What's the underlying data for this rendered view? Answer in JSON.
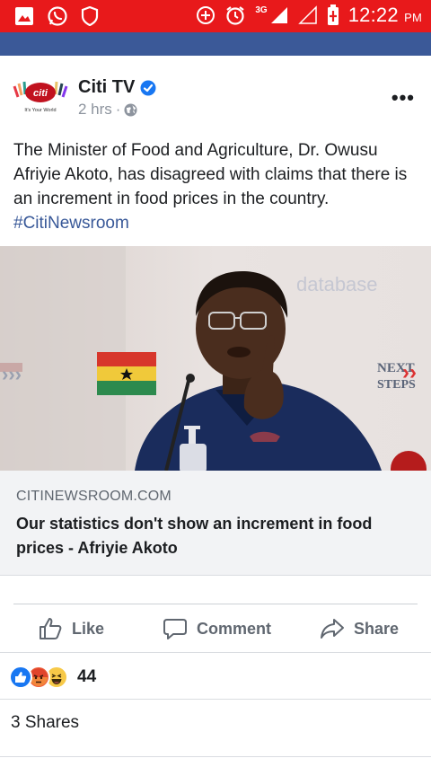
{
  "status_bar": {
    "time": "12:22",
    "ampm": "PM",
    "network": "3G",
    "colors": {
      "background": "#e8191b"
    }
  },
  "post": {
    "page_name": "Citi TV",
    "avatar_text": "citi",
    "avatar_tagline": "It's Your World",
    "timestamp": "2 hrs",
    "separator": "·",
    "body_text": "The Minister of Food and Agriculture, Dr. Owusu Afriyie Akoto, has disagreed with claims that there is an increment in food prices in the country. ",
    "hashtag": "#CitiNewsroom",
    "photo": {
      "banner_text_1": "NEXT",
      "banner_text_2": "STEPS",
      "backdrop_text": "database"
    },
    "link": {
      "domain": "CITINEWSROOM.COM",
      "title": "Our statistics don't show an increment in food prices - Afriyie Akoto"
    },
    "actions": {
      "like": "Like",
      "comment": "Comment",
      "share": "Share"
    },
    "reactions": {
      "icons": [
        "like-icon",
        "angry-icon",
        "haha-icon"
      ],
      "count": "44"
    },
    "shares_text": "3 Shares"
  },
  "colors": {
    "brand": "#3b5998",
    "hashtag": "#385898",
    "verified": "#1877f2"
  }
}
